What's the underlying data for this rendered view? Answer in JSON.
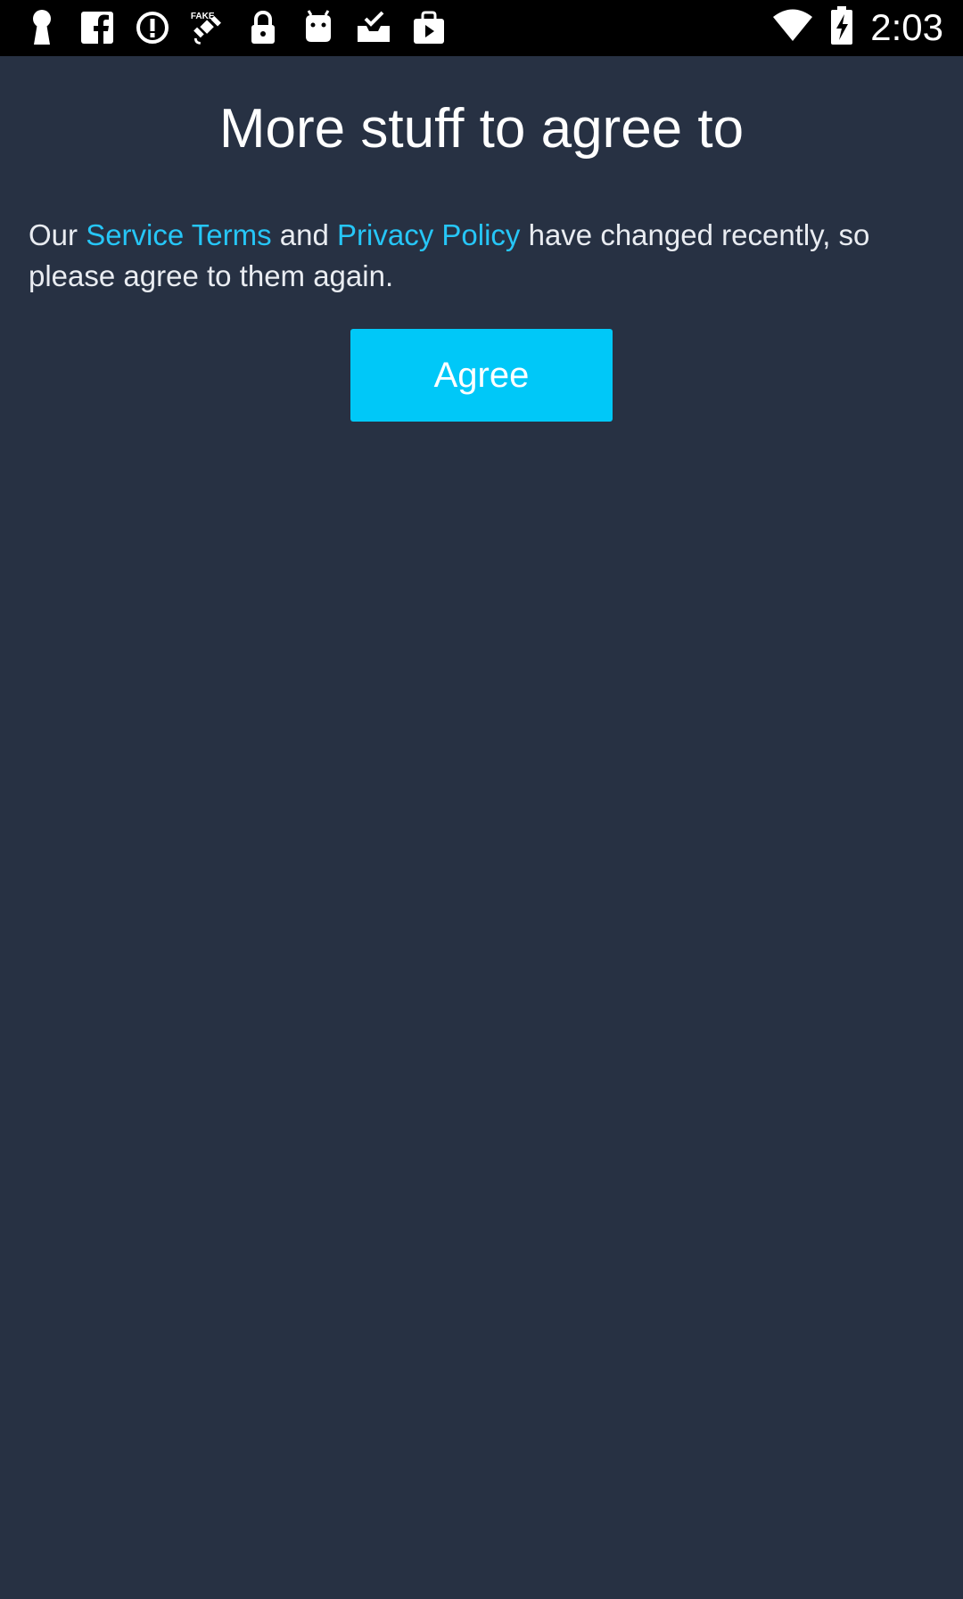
{
  "status_bar": {
    "time": "2:03",
    "left_icons": [
      "keyhole-icon",
      "facebook-icon",
      "info-circle-icon",
      "fake-gps-icon",
      "lock-icon",
      "android-robot-icon",
      "inbox-check-icon",
      "play-store-icon"
    ],
    "right_icons": [
      "wifi-icon",
      "battery-icon"
    ]
  },
  "screen": {
    "title": "More stuff to agree to",
    "message": {
      "prefix": "Our ",
      "service_terms_link": "Service Terms",
      "middle": " and ",
      "privacy_policy_link": "Privacy Policy",
      "suffix": " have changed recently, so please agree to them again."
    },
    "agree_label": "Agree"
  },
  "colors": {
    "background": "#273143",
    "status_bar": "#000000",
    "accent_button": "#00c8f8",
    "link": "#26c6f7",
    "text": "#ffffff"
  }
}
